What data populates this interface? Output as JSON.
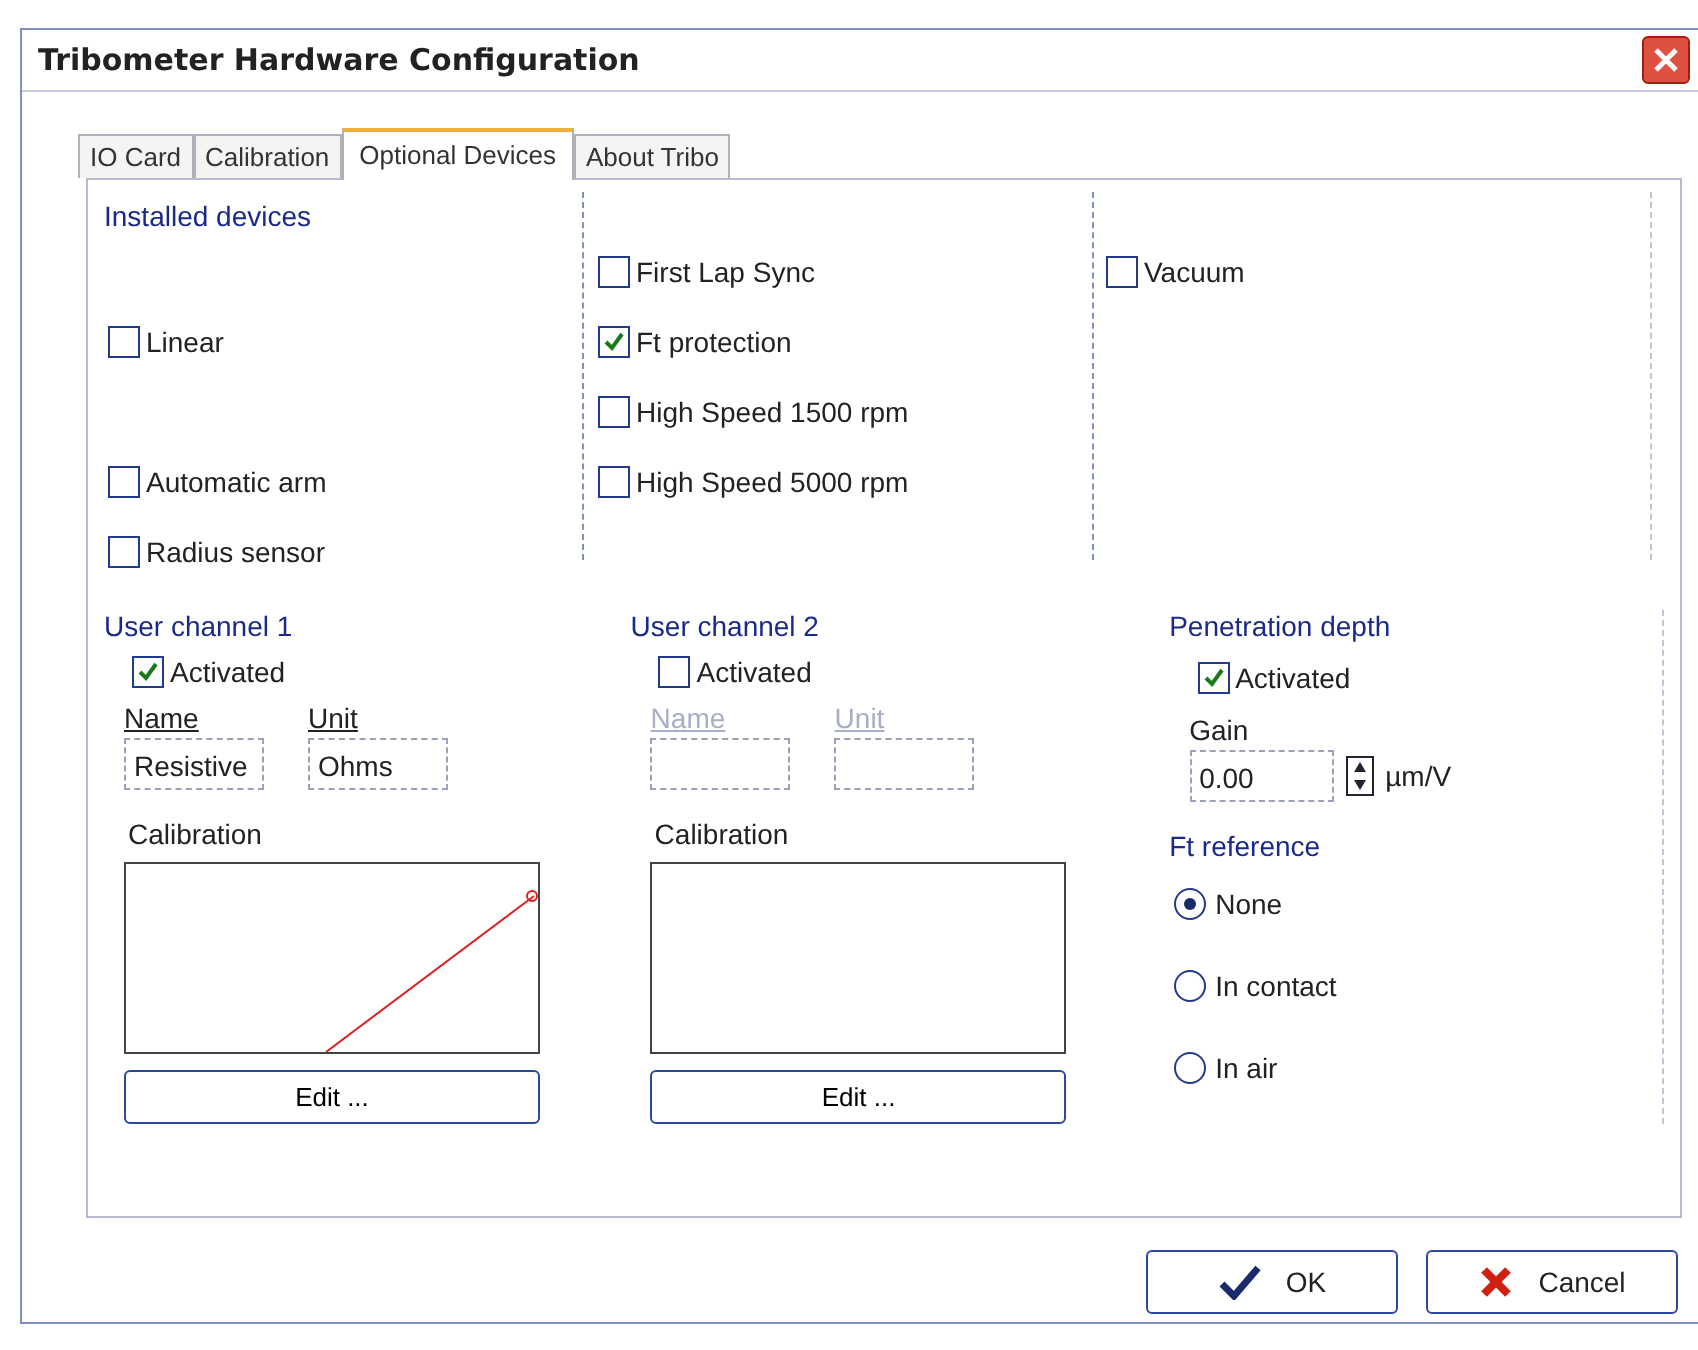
{
  "window": {
    "title": "Tribometer Hardware Configuration"
  },
  "tabs": [
    {
      "label": "IO Card",
      "selected": false
    },
    {
      "label": "Calibration",
      "selected": false
    },
    {
      "label": "Optional Devices",
      "selected": true
    },
    {
      "label": "About Tribo",
      "selected": false
    }
  ],
  "installed_devices": {
    "title": "Installed devices",
    "columns": [
      [
        {
          "kind": "blank"
        },
        {
          "kind": "checkbox",
          "label": "Linear",
          "checked": false
        },
        {
          "kind": "blank"
        },
        {
          "kind": "checkbox",
          "label": "Automatic arm",
          "checked": false
        },
        {
          "kind": "checkbox",
          "label": "Radius sensor",
          "checked": false
        }
      ],
      [
        {
          "kind": "checkbox",
          "label": "First Lap Sync",
          "checked": false
        },
        {
          "kind": "checkbox",
          "label": "Ft protection",
          "checked": true
        },
        {
          "kind": "checkbox",
          "label": "High Speed 1500 rpm",
          "checked": false
        },
        {
          "kind": "checkbox",
          "label": "High Speed 5000 rpm",
          "checked": false
        }
      ],
      [
        {
          "kind": "checkbox",
          "label": "Vacuum",
          "checked": false
        },
        {
          "kind": "blank"
        },
        {
          "kind": "blank"
        },
        {
          "kind": "blank"
        }
      ]
    ]
  },
  "user_channels": [
    {
      "title": "User channel 1",
      "activated_label": "Activated",
      "activated": true,
      "disabled": false,
      "name_label": "Name",
      "unit_label": "Unit",
      "name_value": "Resistive",
      "unit_value": "Ohms",
      "calibration_label": "Calibration",
      "has_curve": true,
      "edit_button": "Edit ..."
    },
    {
      "title": "User channel 2",
      "activated_label": "Activated",
      "activated": false,
      "disabled": true,
      "name_label": "Name",
      "unit_label": "Unit",
      "calibration_label": "Calibration",
      "has_curve": false,
      "edit_button": "Edit ..."
    }
  ],
  "penetration_depth": {
    "title": "Penetration depth",
    "activated_label": "Activated",
    "activated": true,
    "gain_label": "Gain",
    "gain_value": "0.00",
    "gain_unit": "µm/V"
  },
  "ft_reference": {
    "title": "Ft reference",
    "options": [
      {
        "label": "None",
        "selected": true
      },
      {
        "label": "In contact",
        "selected": false
      },
      {
        "label": "In air",
        "selected": false
      }
    ]
  },
  "buttons": [
    {
      "kind": "ok",
      "label": "OK"
    },
    {
      "kind": "cancel",
      "label": "Cancel"
    }
  ]
}
